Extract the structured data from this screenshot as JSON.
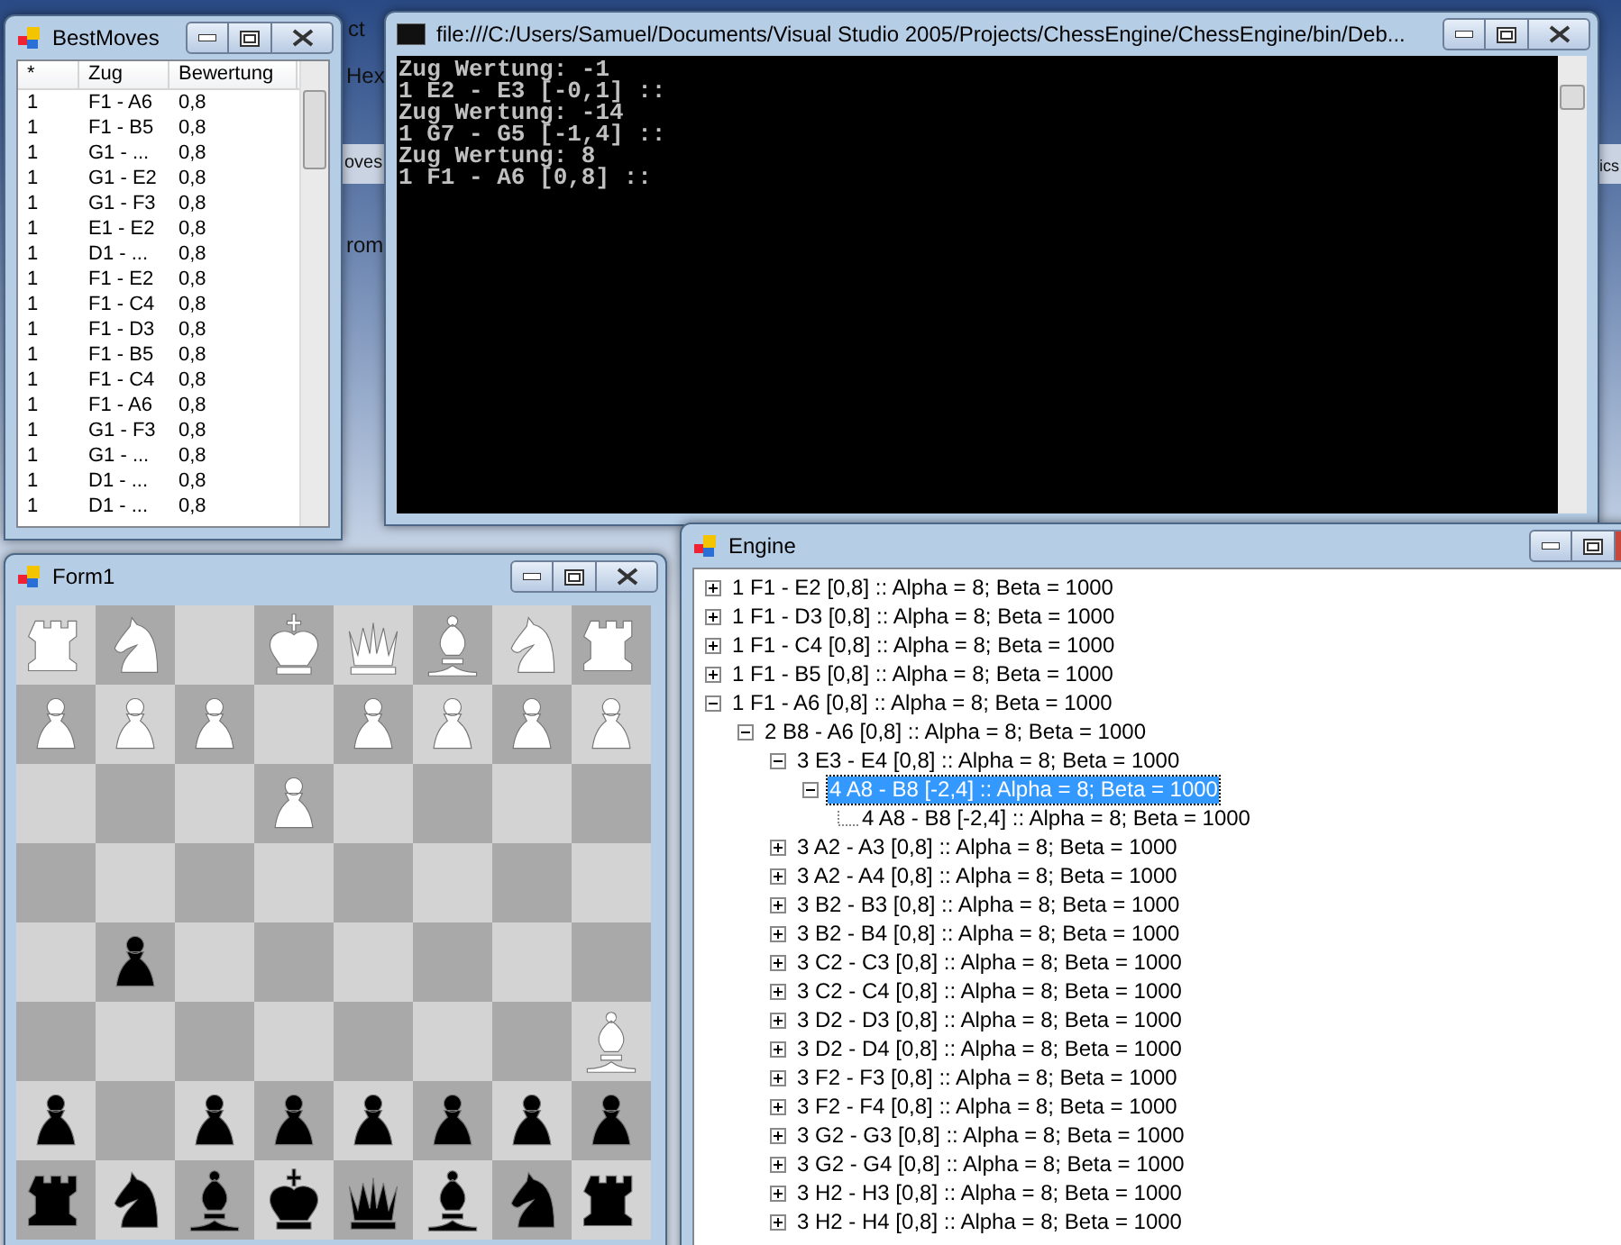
{
  "background": {
    "fragments": [
      "ct",
      "Hex",
      "oves",
      "rom",
      "ics"
    ]
  },
  "best_moves": {
    "title": "BestMoves",
    "columns": [
      "*",
      "Zug",
      "Bewertung"
    ],
    "rows": [
      [
        "1",
        "F1 - A6",
        "0,8"
      ],
      [
        "1",
        "F1 - B5",
        "0,8"
      ],
      [
        "1",
        "G1 - ...",
        "0,8"
      ],
      [
        "1",
        "G1 - E2",
        "0,8"
      ],
      [
        "1",
        "G1 - F3",
        "0,8"
      ],
      [
        "1",
        "E1 - E2",
        "0,8"
      ],
      [
        "1",
        "D1 - ...",
        "0,8"
      ],
      [
        "1",
        "F1 - E2",
        "0,8"
      ],
      [
        "1",
        "F1 - C4",
        "0,8"
      ],
      [
        "1",
        "F1 - D3",
        "0,8"
      ],
      [
        "1",
        "F1 - B5",
        "0,8"
      ],
      [
        "1",
        "F1 - C4",
        "0,8"
      ],
      [
        "1",
        "F1 - A6",
        "0,8"
      ],
      [
        "1",
        "G1 - F3",
        "0,8"
      ],
      [
        "1",
        "G1 - ...",
        "0,8"
      ],
      [
        "1",
        "D1 - ...",
        "0,8"
      ],
      [
        "1",
        "D1 - ...",
        "0,8"
      ]
    ]
  },
  "console": {
    "title": "file:///C:/Users/Samuel/Documents/Visual Studio 2005/Projects/ChessEngine/ChessEngine/bin/Deb...",
    "lines": [
      "Zug Wertung: -1",
      "1 E2 - E3 [-0,1] ::",
      "Zug Wertung: -14",
      "1 G7 - G5 [-1,4] ::",
      "Zug Wertung: 8",
      "1 F1 - A6 [0,8] ::"
    ]
  },
  "form1": {
    "title": "Form1",
    "board": [
      [
        {
          "kind": "rook",
          "color": "#ffffff"
        },
        {
          "kind": "knight",
          "color": "#ffffff"
        },
        {
          "kind": "empty"
        },
        {
          "kind": "king",
          "color": "#ffffff"
        },
        {
          "kind": "queen",
          "color": "#ffffff"
        },
        {
          "kind": "bishop",
          "color": "#ffffff"
        },
        {
          "kind": "knight",
          "color": "#ffffff"
        },
        {
          "kind": "rook",
          "color": "#ffffff"
        }
      ],
      [
        {
          "kind": "pawn",
          "color": "#ffffff"
        },
        {
          "kind": "pawn",
          "color": "#ffffff"
        },
        {
          "kind": "pawn",
          "color": "#ffffff"
        },
        {
          "kind": "empty"
        },
        {
          "kind": "pawn",
          "color": "#ffffff"
        },
        {
          "kind": "pawn",
          "color": "#ffffff"
        },
        {
          "kind": "pawn",
          "color": "#ffffff"
        },
        {
          "kind": "pawn",
          "color": "#ffffff"
        }
      ],
      [
        {
          "kind": "empty"
        },
        {
          "kind": "empty"
        },
        {
          "kind": "empty"
        },
        {
          "kind": "pawn",
          "color": "#ffffff"
        },
        {
          "kind": "empty"
        },
        {
          "kind": "empty"
        },
        {
          "kind": "empty"
        },
        {
          "kind": "empty"
        }
      ],
      [
        {
          "kind": "empty"
        },
        {
          "kind": "empty"
        },
        {
          "kind": "empty"
        },
        {
          "kind": "empty"
        },
        {
          "kind": "empty"
        },
        {
          "kind": "empty"
        },
        {
          "kind": "empty"
        },
        {
          "kind": "empty"
        }
      ],
      [
        {
          "kind": "empty"
        },
        {
          "kind": "pawn",
          "color": "#000000"
        },
        {
          "kind": "empty"
        },
        {
          "kind": "empty"
        },
        {
          "kind": "empty"
        },
        {
          "kind": "empty"
        },
        {
          "kind": "empty"
        },
        {
          "kind": "empty"
        }
      ],
      [
        {
          "kind": "empty"
        },
        {
          "kind": "empty"
        },
        {
          "kind": "empty"
        },
        {
          "kind": "empty"
        },
        {
          "kind": "empty"
        },
        {
          "kind": "empty"
        },
        {
          "kind": "empty"
        },
        {
          "kind": "bishop",
          "color": "#ffffff"
        }
      ],
      [
        {
          "kind": "pawn",
          "color": "#000000"
        },
        {
          "kind": "empty"
        },
        {
          "kind": "pawn",
          "color": "#000000"
        },
        {
          "kind": "pawn",
          "color": "#000000"
        },
        {
          "kind": "pawn",
          "color": "#000000"
        },
        {
          "kind": "pawn",
          "color": "#000000"
        },
        {
          "kind": "pawn",
          "color": "#000000"
        },
        {
          "kind": "pawn",
          "color": "#000000"
        }
      ],
      [
        {
          "kind": "rook",
          "color": "#000000"
        },
        {
          "kind": "knight",
          "color": "#000000"
        },
        {
          "kind": "bishop",
          "color": "#000000"
        },
        {
          "kind": "king",
          "color": "#000000"
        },
        {
          "kind": "queen",
          "color": "#000000"
        },
        {
          "kind": "bishop",
          "color": "#000000"
        },
        {
          "kind": "knight",
          "color": "#000000"
        },
        {
          "kind": "rook",
          "color": "#000000"
        }
      ]
    ]
  },
  "engine": {
    "title": "Engine",
    "tree": [
      {
        "label": "1 F1 - E2 [0,8] :: Alpha = 8; Beta = 1000",
        "expanded": false,
        "selected": false
      },
      {
        "label": "1 F1 - D3 [0,8] :: Alpha = 8; Beta = 1000",
        "expanded": false,
        "selected": false
      },
      {
        "label": "1 F1 - C4 [0,8] :: Alpha = 8; Beta = 1000",
        "expanded": false,
        "selected": false
      },
      {
        "label": "1 F1 - B5 [0,8] :: Alpha = 8; Beta = 1000",
        "expanded": false,
        "selected": false
      },
      {
        "label": "1 F1 - A6 [0,8] :: Alpha = 8; Beta = 1000",
        "expanded": true,
        "selected": false,
        "children": [
          {
            "label": "2 B8 - A6 [0,8] :: Alpha = 8; Beta = 1000",
            "expanded": true,
            "selected": false,
            "children": [
              {
                "label": "3 E3 - E4 [0,8] :: Alpha = 8; Beta = 1000",
                "expanded": true,
                "selected": false,
                "children": [
                  {
                    "label": "4 A8 - B8 [-2,4] :: Alpha = 8; Beta = 1000",
                    "expanded": true,
                    "selected": true,
                    "children": [
                      {
                        "label": "4 A8 - B8 [-2,4] :: Alpha = 8; Beta = 1000",
                        "selected": false
                      }
                    ]
                  }
                ]
              },
              {
                "label": "3 A2 - A3 [0,8] :: Alpha = 8; Beta = 1000",
                "expanded": false,
                "selected": false
              },
              {
                "label": "3 A2 - A4 [0,8] :: Alpha = 8; Beta = 1000",
                "expanded": false,
                "selected": false
              },
              {
                "label": "3 B2 - B3 [0,8] :: Alpha = 8; Beta = 1000",
                "expanded": false,
                "selected": false
              },
              {
                "label": "3 B2 - B4 [0,8] :: Alpha = 8; Beta = 1000",
                "expanded": false,
                "selected": false
              },
              {
                "label": "3 C2 - C3 [0,8] :: Alpha = 8; Beta = 1000",
                "expanded": false,
                "selected": false
              },
              {
                "label": "3 C2 - C4 [0,8] :: Alpha = 8; Beta = 1000",
                "expanded": false,
                "selected": false
              },
              {
                "label": "3 D2 - D3 [0,8] :: Alpha = 8; Beta = 1000",
                "expanded": false,
                "selected": false
              },
              {
                "label": "3 D2 - D4 [0,8] :: Alpha = 8; Beta = 1000",
                "expanded": false,
                "selected": false
              },
              {
                "label": "3 F2 - F3 [0,8] :: Alpha = 8; Beta = 1000",
                "expanded": false,
                "selected": false
              },
              {
                "label": "3 F2 - F4 [0,8] :: Alpha = 8; Beta = 1000",
                "expanded": false,
                "selected": false
              },
              {
                "label": "3 G2 - G3 [0,8] :: Alpha = 8; Beta = 1000",
                "expanded": false,
                "selected": false
              },
              {
                "label": "3 G2 - G4 [0,8] :: Alpha = 8; Beta = 1000",
                "expanded": false,
                "selected": false
              },
              {
                "label": "3 H2 - H3 [0,8] :: Alpha = 8; Beta = 1000",
                "expanded": false,
                "selected": false
              },
              {
                "label": "3 H2 - H4 [0,8] :: Alpha = 8; Beta = 1000",
                "expanded": false,
                "selected": false
              }
            ]
          }
        ]
      }
    ]
  }
}
